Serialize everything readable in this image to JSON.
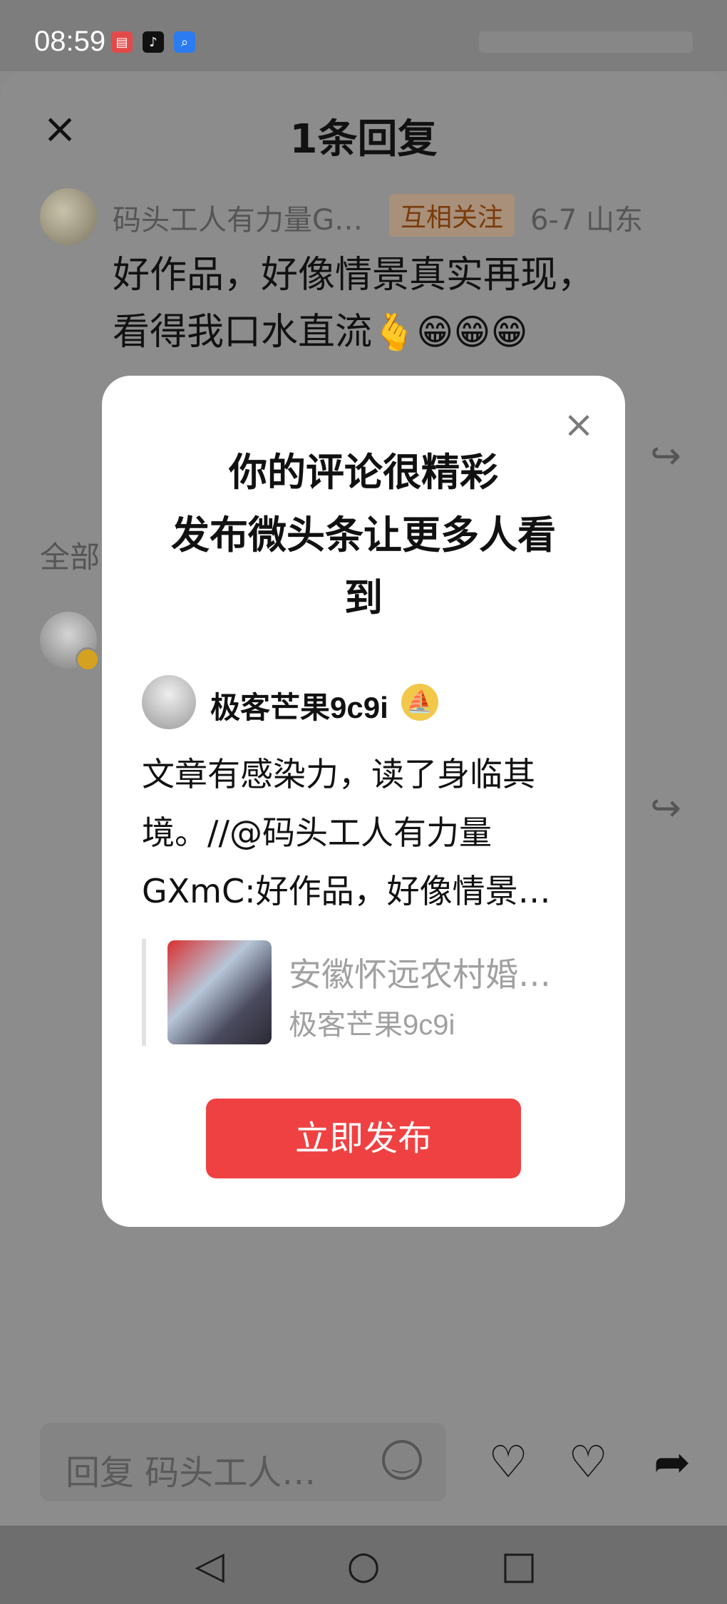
{
  "status_bar": {
    "time": "08:59"
  },
  "sheet": {
    "title": "1条回复",
    "comment": {
      "user": "码头工人有力量G…",
      "badge": "互相关注",
      "meta": "6-7  山东",
      "text_line1": "好作品，好像情景真实再现，",
      "text_line2": "看得我口水直流",
      "emojis": "🫰😁😁😁"
    },
    "all_label": "全部",
    "reply_placeholder": "回复 码头工人…"
  },
  "modal": {
    "title_line1": "你的评论很精彩",
    "title_line2": "发布微头条让更多人看",
    "title_line3": "到",
    "author": "极客芒果9c9i",
    "repost_text": "文章有感染力，读了身临其境。//@码头工人有力量GXmC:好作品，好像情景…",
    "quote_title": "安徽怀远农村婚…",
    "quote_author": "极客芒果9c9i",
    "publish_label": "立即发布"
  },
  "colors": {
    "accent": "#f04142",
    "overlay": "#8c8c8c",
    "modal_bg": "#ffffff"
  },
  "icons": [
    "close-icon",
    "share-icon",
    "smile-icon",
    "like-icon",
    "dislike-icon",
    "forward-icon",
    "back-nav-icon",
    "home-nav-icon",
    "recents-nav-icon"
  ]
}
